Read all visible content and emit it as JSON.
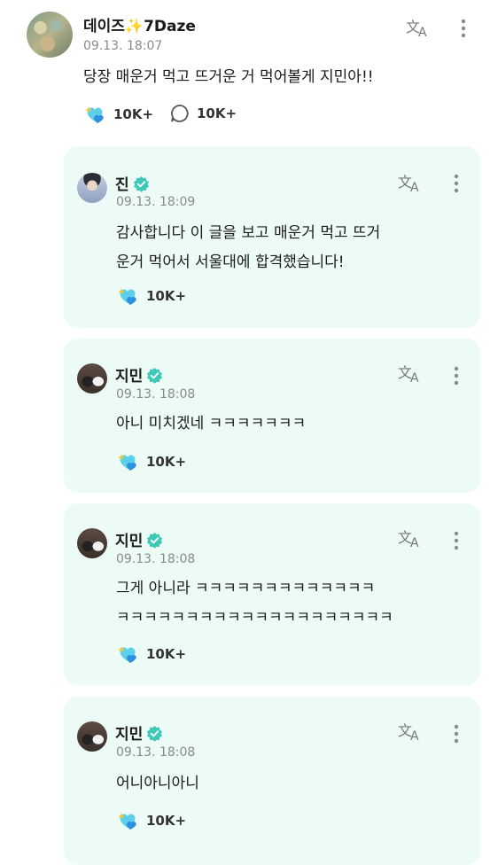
{
  "post": {
    "author": "데이즈✨7Daze",
    "date": "09.13. 18:07",
    "text": "당장 매운거 먹고 뜨거운 거 먹어볼게 지민아!!",
    "likes": "10K+",
    "comments": "10K+"
  },
  "replies": [
    {
      "author": "진",
      "date": "09.13. 18:09",
      "lines": [
        "감사합니다 이 글을 보고 매운거 먹고 뜨거",
        "운거 먹어서 서울대에 합격했습니다!"
      ],
      "likes": "10K+"
    },
    {
      "author": "지민",
      "date": "09.13. 18:08",
      "lines": [
        "아니 미치겠네 ㅋㅋㅋㅋㅋㅋㅋ"
      ],
      "likes": "10K+"
    },
    {
      "author": "지민",
      "date": "09.13. 18:08",
      "lines": [
        "그게 아니라 ㅋㅋㅋㅋㅋㅋㅋㅋㅋㅋㅋㅋㅋ",
        "ㅋㅋㅋㅋㅋㅋㅋㅋㅋㅋㅋㅋㅋㅋㅋㅋㅋㅋㅋㅋ"
      ],
      "likes": "10K+"
    },
    {
      "author": "지민",
      "date": "09.13. 18:08",
      "lines": [
        "어니아니아니"
      ],
      "likes": "10K+"
    }
  ],
  "colors": {
    "card_bg": "#ecfbf5",
    "verified": "#3cc9b7",
    "heart_sparkle": "#5bd0e8"
  },
  "icons": {
    "translate": "translate-icon",
    "more": "more-vertical-icon",
    "like": "sparkle-heart-icon",
    "comment": "comment-bubble-icon",
    "verified": "verified-check-icon"
  }
}
